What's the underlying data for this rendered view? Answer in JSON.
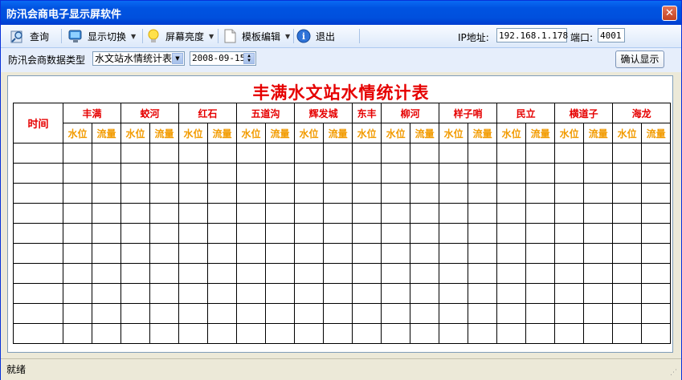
{
  "window": {
    "title": "防汛会商电子显示屏软件",
    "close_glyph": "✕"
  },
  "toolbar": {
    "query": "查询",
    "display_switch": "显示切换",
    "brightness": "屏幕亮度",
    "template_edit": "模板编辑",
    "exit": "退出",
    "ip_label": "IP地址:",
    "ip_value": "192.168.1.178",
    "port_label": "端口:",
    "port_value": "4001"
  },
  "filter": {
    "type_label": "防汛会商数据类型",
    "type_value": "水文站水情统计表",
    "date_value": "2008-09-15",
    "confirm_button": "确认显示"
  },
  "table": {
    "title": "丰满水文站水情统计表",
    "time_header": "时间",
    "stations": [
      {
        "name": "丰满",
        "subs": [
          "水位",
          "流量"
        ]
      },
      {
        "name": "蛟河",
        "subs": [
          "水位",
          "流量"
        ]
      },
      {
        "name": "红石",
        "subs": [
          "水位",
          "流量"
        ]
      },
      {
        "name": "五道沟",
        "subs": [
          "水位",
          "流量"
        ]
      },
      {
        "name": "辉发城",
        "subs": [
          "水位",
          "流量"
        ]
      },
      {
        "name": "东丰",
        "subs": [
          "水位"
        ]
      },
      {
        "name": "柳河",
        "subs": [
          "水位",
          "流量"
        ]
      },
      {
        "name": "样子哨",
        "subs": [
          "水位",
          "流量"
        ]
      },
      {
        "name": "民立",
        "subs": [
          "水位",
          "流量"
        ]
      },
      {
        "name": "横道子",
        "subs": [
          "水位",
          "流量"
        ]
      },
      {
        "name": "海龙",
        "subs": [
          "水位",
          "流量"
        ]
      }
    ],
    "row_count": 10
  },
  "status": {
    "text": "就绪"
  },
  "colors": {
    "title_red": "#e60000",
    "sub_orange": "#f29b00",
    "titlebar_blue": "#0053e1"
  }
}
